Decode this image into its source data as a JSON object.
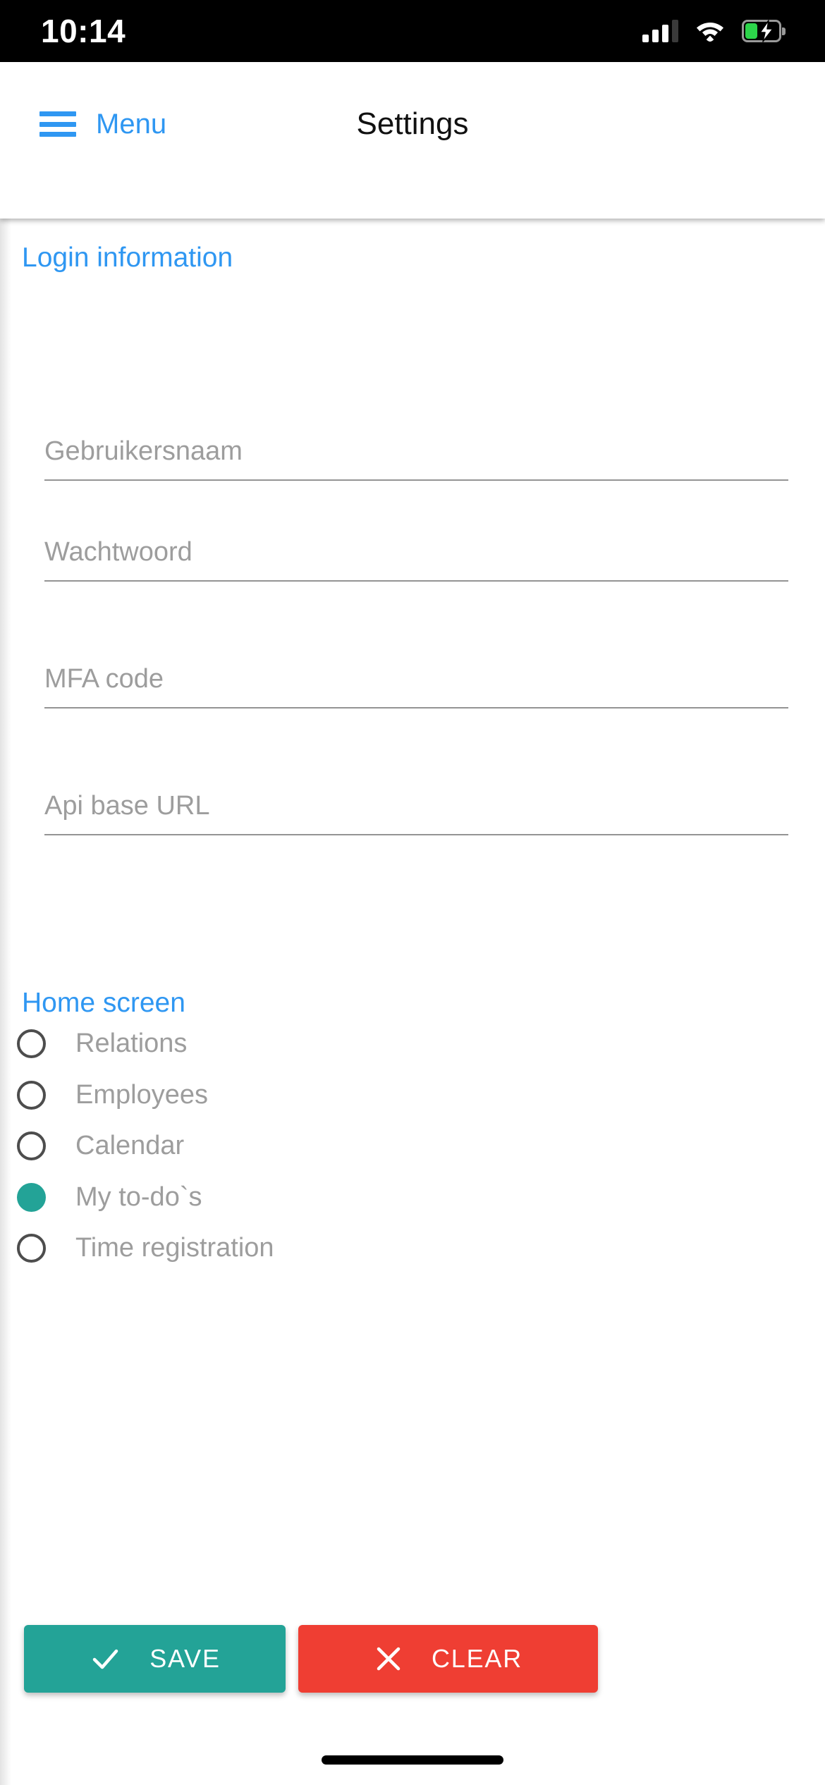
{
  "status_bar": {
    "time": "10:14",
    "signal_icon": "signal-bars-icon",
    "wifi_icon": "wifi-icon",
    "battery_icon": "battery-charging-icon"
  },
  "header": {
    "menu_icon": "hamburger-menu-icon",
    "menu_label": "Menu",
    "title": "Settings"
  },
  "sections": {
    "login": {
      "title": "Login information",
      "fields": [
        {
          "name": "username",
          "placeholder": "Gebruikersnaam",
          "value": ""
        },
        {
          "name": "password",
          "placeholder": "Wachtwoord",
          "value": ""
        },
        {
          "name": "mfa-code",
          "placeholder": "MFA code",
          "value": ""
        },
        {
          "name": "api-base-url",
          "placeholder": "Api base URL",
          "value": ""
        }
      ]
    },
    "home_screen": {
      "title": "Home screen",
      "options": [
        {
          "label": "Relations",
          "selected": false
        },
        {
          "label": "Employees",
          "selected": false
        },
        {
          "label": "Calendar",
          "selected": false
        },
        {
          "label": "My to-do`s",
          "selected": true
        },
        {
          "label": "Time registration",
          "selected": false
        }
      ]
    }
  },
  "actions": {
    "save": {
      "label": "SAVE",
      "icon": "check-icon"
    },
    "clear": {
      "label": "CLEAR",
      "icon": "close-x-icon"
    }
  },
  "colors": {
    "accent_blue": "#2f97f2",
    "teal": "#23a397",
    "red": "#ef3e33",
    "placeholder_gray": "#9d9d9d",
    "battery_green": "#2cd44a"
  }
}
